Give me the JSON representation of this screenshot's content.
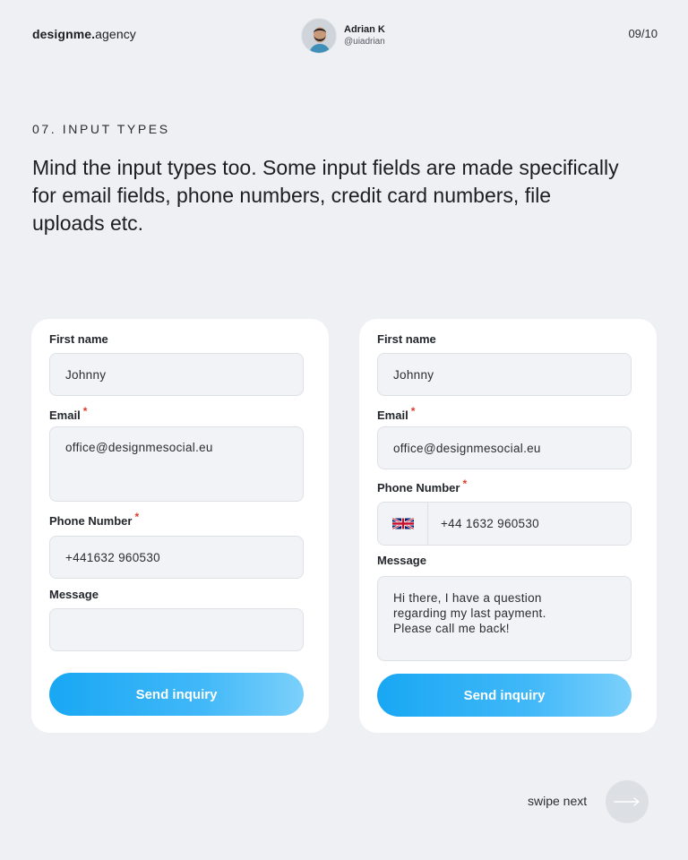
{
  "header": {
    "brand_bold": "designme.",
    "brand_light": "agency",
    "author_name": "Adrian K",
    "author_handle": "@uiadrian",
    "page_indicator": "09/10"
  },
  "section": {
    "label": "07. INPUT TYPES",
    "headline": "Mind the input types too. Some input fields are made specifically for email fields, phone numbers, credit card numbers, file uploads etc."
  },
  "form_left": {
    "first_name_label": "First name",
    "first_name_value": "Johnny",
    "email_label": "Email",
    "email_value": "office@designmesocial.eu",
    "phone_label": "Phone Number",
    "phone_value": "+441632 960530",
    "message_label": "Message",
    "message_value": "",
    "submit_label": "Send inquiry",
    "required_mark": "*"
  },
  "form_right": {
    "first_name_label": "First name",
    "first_name_value": "Johnny",
    "email_label": "Email",
    "email_value": "office@designmesocial.eu",
    "phone_label": "Phone Number",
    "phone_country_icon": "uk-flag-icon",
    "phone_value": "+44 1632 960530",
    "message_label": "Message",
    "message_value": "Hi there, I have a question\nregarding my last payment.\nPlease call me back!",
    "submit_label": "Send inquiry",
    "required_mark": "*"
  },
  "footer": {
    "swipe_label": "swipe next",
    "next_icon": "arrow-right-icon"
  },
  "colors": {
    "background": "#eef0f4",
    "card": "#ffffff",
    "field_bg": "#f1f3f6",
    "button_gradient_start": "#19a7f3",
    "button_gradient_end": "#7cd0fb",
    "required": "#e0392b"
  }
}
